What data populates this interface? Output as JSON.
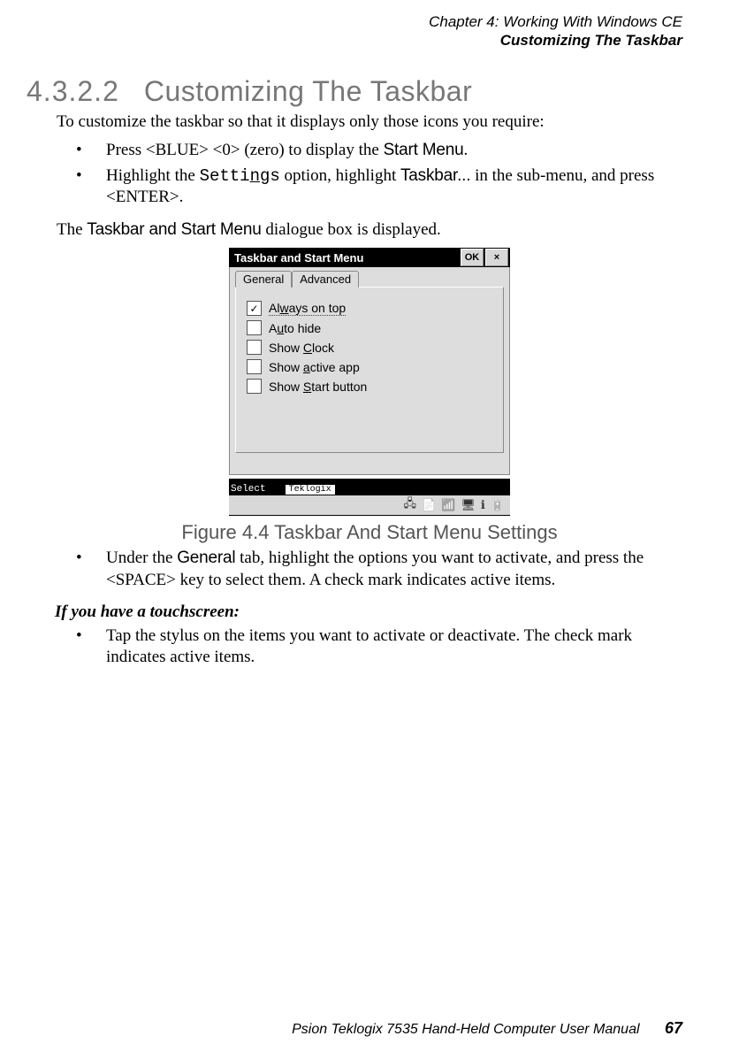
{
  "header": {
    "chapter_line": "Chapter  4:  Working With Windows CE",
    "section_line": "Customizing The Taskbar"
  },
  "heading": {
    "number": "4.3.2.2",
    "title": "Customizing The Taskbar"
  },
  "intro": "To customize the taskbar so that it displays only those icons you require:",
  "bullets1": {
    "b1_pre": "Press <BLUE> <0> (zero) to display the ",
    "b1_cond": "Start Menu",
    "b1_post": ".",
    "b2_pre": "Highlight the ",
    "b2_mono_a": "Setti",
    "b2_mono_b": "n",
    "b2_mono_c": "gs",
    "b2_mid": " option, highlight ",
    "b2_cond": "Taskbar...",
    "b2_post": " in the sub-menu, and press <ENTER>."
  },
  "dialogue_sentence": {
    "pre": "The ",
    "cond": "Taskbar and Start Menu",
    "post": " dialogue box is displayed."
  },
  "dialog": {
    "title": "Taskbar and Start Menu",
    "ok": "OK",
    "close": "×",
    "tabs": {
      "general": "General",
      "advanced": "Advanced"
    },
    "options": [
      {
        "checked": true,
        "pre": "Al",
        "u": "w",
        "post": "ays on top"
      },
      {
        "checked": false,
        "pre": "A",
        "u": "u",
        "post": "to hide"
      },
      {
        "checked": false,
        "pre": "Show ",
        "u": "C",
        "post": "lock"
      },
      {
        "checked": false,
        "pre": "Show ",
        "u": "a",
        "post": "ctive app"
      },
      {
        "checked": false,
        "pre": "Show ",
        "u": "S",
        "post": "tart button"
      }
    ],
    "taskbar": {
      "select": "Select",
      "teklogix": "Teklogix"
    }
  },
  "figure_caption": "Figure 4.4 Taskbar And Start Menu Settings",
  "bullets2": {
    "pre": "Under the ",
    "cond": "General",
    "post": " tab, highlight the options you want to activate, and press the <SPACE> key to select them. A check mark indicates active items."
  },
  "touch_heading": "If you have a touchscreen:",
  "bullets3": {
    "text": "Tap the stylus on the items you want to activate or deactivate. The check mark indicates active items."
  },
  "footer": {
    "manual": "Psion Teklogix 7535 Hand-Held Computer User Manual",
    "page": "67"
  }
}
